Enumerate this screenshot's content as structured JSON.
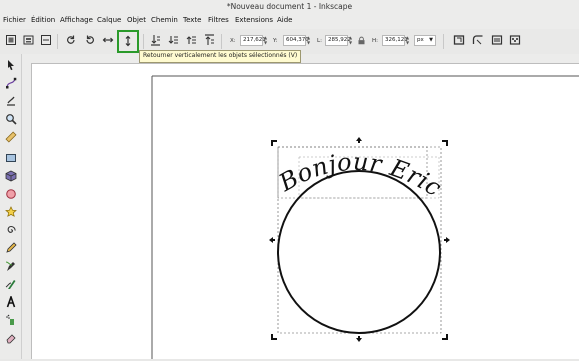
{
  "window": {
    "title": "*Nouveau document 1 - Inkscape"
  },
  "menu": [
    "Fichier",
    "Édition",
    "Affichage",
    "Calque",
    "Objet",
    "Chemin",
    "Texte",
    "Filtres",
    "Extensions",
    "Aide"
  ],
  "toolbar": {
    "x_label": "X:",
    "x_value": "217,621",
    "y_label": "Y:",
    "y_value": "604,370",
    "w_label": "L:",
    "w_value": "285,922",
    "h_label": "H:",
    "h_value": "326,121",
    "unit": "px",
    "tooltip": "Retourner verticalement les objets sélectionnés (V)"
  },
  "canvas": {
    "text": "Bonjour Eric"
  },
  "colors": {
    "highlight": "#2a9a2a",
    "tooltip_bg": "#fffbd0"
  }
}
